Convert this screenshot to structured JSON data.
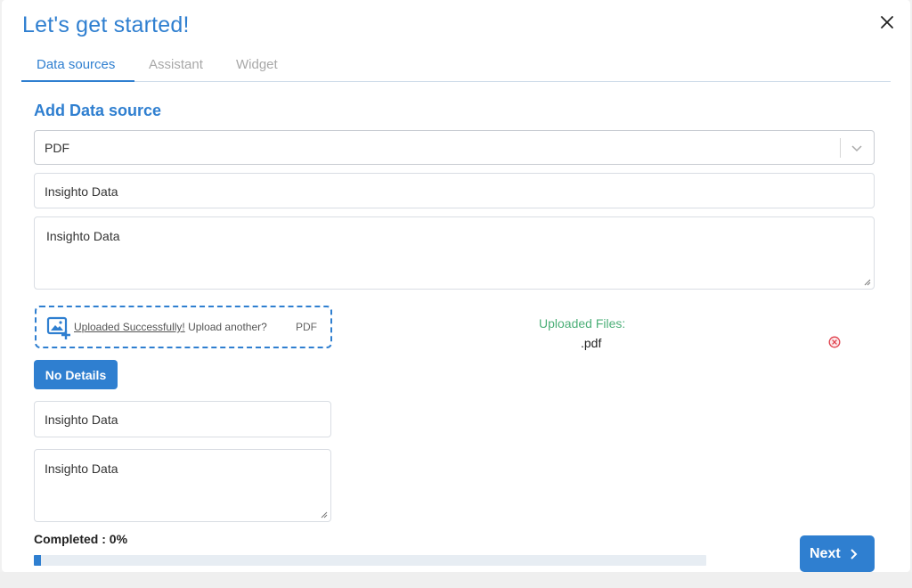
{
  "dialog": {
    "title": "Let's get started!"
  },
  "tabs": [
    {
      "label": "Data sources",
      "active": true
    },
    {
      "label": "Assistant",
      "active": false
    },
    {
      "label": "Widget",
      "active": false
    }
  ],
  "section": {
    "title": "Add Data source"
  },
  "source_select": {
    "value": "PDF"
  },
  "name_input": {
    "value": "Insighto Data"
  },
  "description_textarea": {
    "value": "Insighto Data"
  },
  "upload": {
    "success_link": "Uploaded Successfully!",
    "again_text": " Upload another?",
    "file_type": "PDF"
  },
  "uploaded_files": {
    "label": "Uploaded Files:",
    "files": [
      {
        "name": ".pdf"
      }
    ]
  },
  "no_details_button": {
    "label": "No Details"
  },
  "detail_input": {
    "value": "Insighto Data"
  },
  "detail_textarea": {
    "value": "Insighto Data"
  },
  "progress": {
    "label": "Completed : 0%",
    "fraction": 0.01
  },
  "next_button": {
    "label": "Next"
  },
  "colors": {
    "accent": "#2f7fd0",
    "success": "#4caf78",
    "danger": "#e0424e"
  },
  "icons": {
    "close": "close-icon",
    "dropdown": "chevron-down-icon",
    "upload": "image-add-icon",
    "remove": "remove-circle-icon",
    "next": "chevron-right-icon"
  }
}
